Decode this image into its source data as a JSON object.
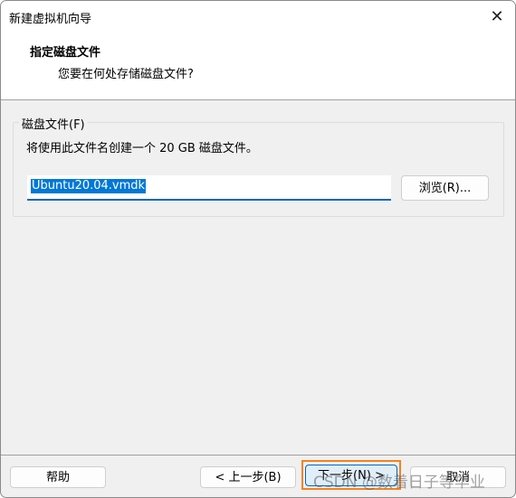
{
  "window": {
    "title": "新建虚拟机向导",
    "close_icon": "close-icon"
  },
  "header": {
    "heading": "指定磁盘文件",
    "subheading": "您要在何处存储磁盘文件?"
  },
  "disk_file": {
    "group_label": "磁盘文件(F)",
    "description": "将使用此文件名创建一个 20 GB 磁盘文件。",
    "filename_value": "Ubuntu20.04.vmdk",
    "browse_label": "浏览(R)..."
  },
  "footer": {
    "help": "帮助",
    "back": "< 上一步(B)",
    "next": "下一步(N) >",
    "cancel": "取消"
  },
  "watermark": "CSDN @数着日子等毕业",
  "colors": {
    "accent": "#0078d7",
    "focus_highlight": "#f58220"
  }
}
